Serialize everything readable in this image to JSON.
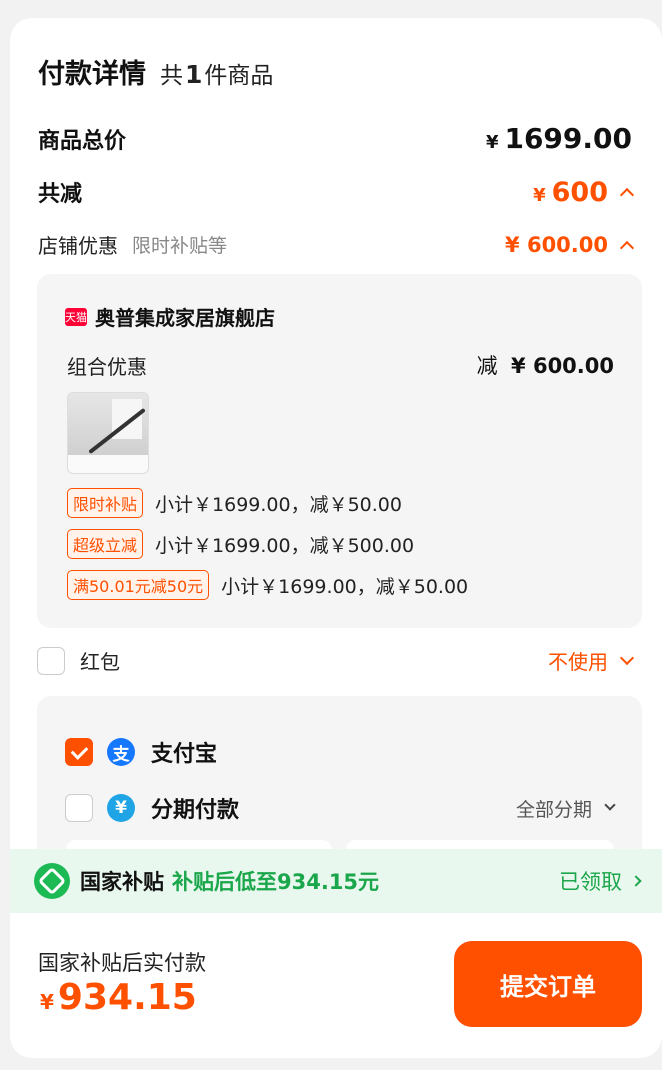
{
  "header": {
    "title": "付款详情",
    "count_prefix": "共",
    "count": "1",
    "count_suffix": "件商品"
  },
  "summary": {
    "total_label": "商品总价",
    "total_currency": "¥",
    "total_value": "1699.00",
    "saving_label": "共减",
    "saving_currency": "¥",
    "saving_value": "600",
    "shop_discount_label": "店铺优惠",
    "shop_discount_sub": "限时补贴等",
    "shop_discount_value": "¥ 600.00"
  },
  "store": {
    "logo_text": "天猫",
    "name": "奥普集成家居旗舰店",
    "combo_label": "组合优惠",
    "combo_prefix": "减",
    "combo_value": "¥ 600.00",
    "discounts": [
      {
        "tag": "限时补贴",
        "text": "小计￥1699.00，减￥50.00"
      },
      {
        "tag": "超级立减",
        "text": "小计￥1699.00，减￥500.00"
      },
      {
        "tag": "满50.01元减50元",
        "text": "小计￥1699.00，减￥50.00"
      }
    ]
  },
  "red_packet": {
    "label": "红包",
    "value": "不使用"
  },
  "payment": {
    "alipay_icon": "支",
    "alipay_label": "支付宝",
    "installment_icon": "¥",
    "installment_label": "分期付款",
    "installment_option": "全部分期"
  },
  "subsidy": {
    "label": "国家补贴",
    "text": "补贴后低至934.15元",
    "status": "已领取"
  },
  "footer": {
    "pay_label": "国家补贴后实付款",
    "pay_currency": "¥",
    "pay_value": "934.15",
    "submit_label": "提交订单"
  },
  "colors": {
    "accent": "#ff5000",
    "subsidy_green": "#1aa64a",
    "subsidy_bg": "#e9f8ee"
  }
}
